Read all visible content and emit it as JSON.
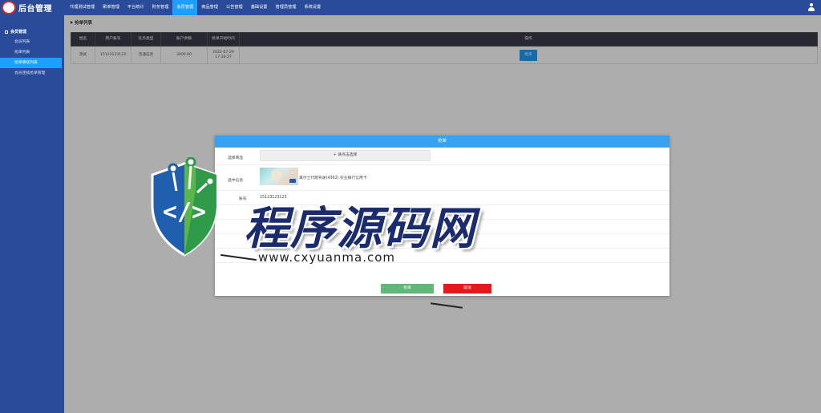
{
  "app": {
    "title": "后台管理"
  },
  "nav": {
    "items": [
      {
        "label": "代理测试管理",
        "active": false
      },
      {
        "label": "刷单管理",
        "active": false
      },
      {
        "label": "平台统计",
        "active": false
      },
      {
        "label": "财务管理",
        "active": false
      },
      {
        "label": "会员管理",
        "active": true
      },
      {
        "label": "商品管理",
        "active": false
      },
      {
        "label": "公告管理",
        "active": false
      },
      {
        "label": "基础设置",
        "active": false
      },
      {
        "label": "管理员管理",
        "active": false
      },
      {
        "label": "系统设置",
        "active": false
      }
    ]
  },
  "sidebar": {
    "group": "会员管理",
    "items": [
      {
        "label": "会员列表",
        "active": false
      },
      {
        "label": "抢单列表",
        "active": false
      },
      {
        "label": "抢单审核列表",
        "active": true
      },
      {
        "label": "会员连续抢单管理",
        "active": false
      }
    ]
  },
  "page": {
    "breadcrumb": "抢单列表"
  },
  "table": {
    "headers": [
      "姓名",
      "用户账号",
      "任务类型",
      "账户余额",
      "抢单开始时间",
      "操作"
    ],
    "rows": [
      {
        "name": "测试",
        "account": "15123123123",
        "type": "普通任务",
        "balance": "3000.00",
        "start_date": "2022-07-29",
        "start_time": "17:16:27",
        "action": "抢单"
      }
    ]
  },
  "dialog": {
    "title": "抢单",
    "choose_label": "选择商品",
    "choose_button": "+ 请点击选择",
    "selected_label": "选中信息",
    "goods_name": "美尔士代跑驾驶(4362) 农业银行信用卡",
    "account_label": "账号",
    "account_value": "15123123123",
    "ok_label": "抢单",
    "cancel_label": "取消"
  },
  "watermark": {
    "title": "程序源码网",
    "url": "www.cxyuanma.com"
  },
  "colors": {
    "primary_blue": "#2a4b9a",
    "accent": "#1e9fff",
    "header_dark": "#393d49",
    "ok_green": "#5fb878",
    "cancel_red": "#e5181c"
  }
}
